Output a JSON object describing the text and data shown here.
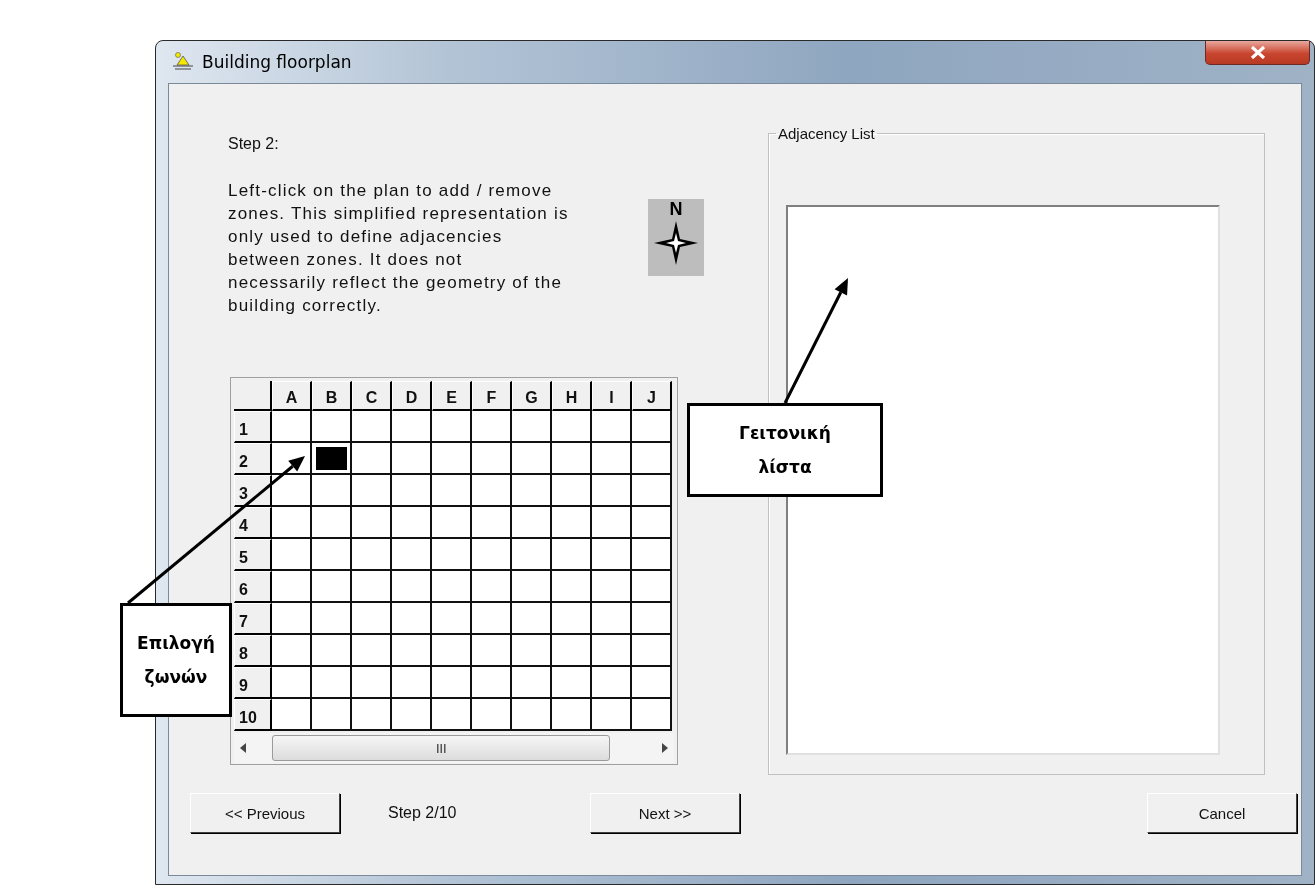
{
  "window": {
    "title": "Building floorplan"
  },
  "step_heading": "Step 2:",
  "instructions": [
    "Left-click on the plan to add / remove",
    "zones. This simplified representation is",
    "only used to define adjacencies",
    "between zones. It does not",
    "necessarily reflect the geometry of the",
    "building correctly."
  ],
  "compass": {
    "label": "N"
  },
  "floorplan_grid": {
    "columns": [
      "A",
      "B",
      "C",
      "D",
      "E",
      "F",
      "G",
      "H",
      "I",
      "J"
    ],
    "rows": [
      {
        "label": "1",
        "cells": [
          false,
          false,
          false,
          false,
          false,
          false,
          false,
          false,
          false,
          false
        ]
      },
      {
        "label": "2",
        "cells": [
          false,
          true,
          false,
          false,
          false,
          false,
          false,
          false,
          false,
          false
        ]
      },
      {
        "label": "3",
        "cells": [
          false,
          false,
          false,
          false,
          false,
          false,
          false,
          false,
          false,
          false
        ]
      },
      {
        "label": "4",
        "cells": [
          false,
          false,
          false,
          false,
          false,
          false,
          false,
          false,
          false,
          false
        ]
      },
      {
        "label": "5",
        "cells": [
          false,
          false,
          false,
          false,
          false,
          false,
          false,
          false,
          false,
          false
        ]
      },
      {
        "label": "6",
        "cells": [
          false,
          false,
          false,
          false,
          false,
          false,
          false,
          false,
          false,
          false
        ]
      },
      {
        "label": "7",
        "cells": [
          false,
          false,
          false,
          false,
          false,
          false,
          false,
          false,
          false,
          false
        ]
      },
      {
        "label": "8",
        "cells": [
          false,
          false,
          false,
          false,
          false,
          false,
          false,
          false,
          false,
          false
        ]
      },
      {
        "label": "9",
        "cells": [
          false,
          false,
          false,
          false,
          false,
          false,
          false,
          false,
          false,
          false
        ]
      },
      {
        "label": "10",
        "cells": [
          false,
          false,
          false,
          false,
          false,
          false,
          false,
          false,
          false,
          false
        ]
      }
    ]
  },
  "adjacency_list": {
    "title": "Adjacency List"
  },
  "footer": {
    "previous": "<< Previous",
    "step_label": "Step 2/10",
    "next": "Next >>",
    "cancel": "Cancel"
  },
  "annotations": [
    {
      "lines": [
        "Επιλογή",
        "ζωνών"
      ]
    },
    {
      "lines": [
        "Γειτονική",
        "λίστα"
      ]
    }
  ]
}
